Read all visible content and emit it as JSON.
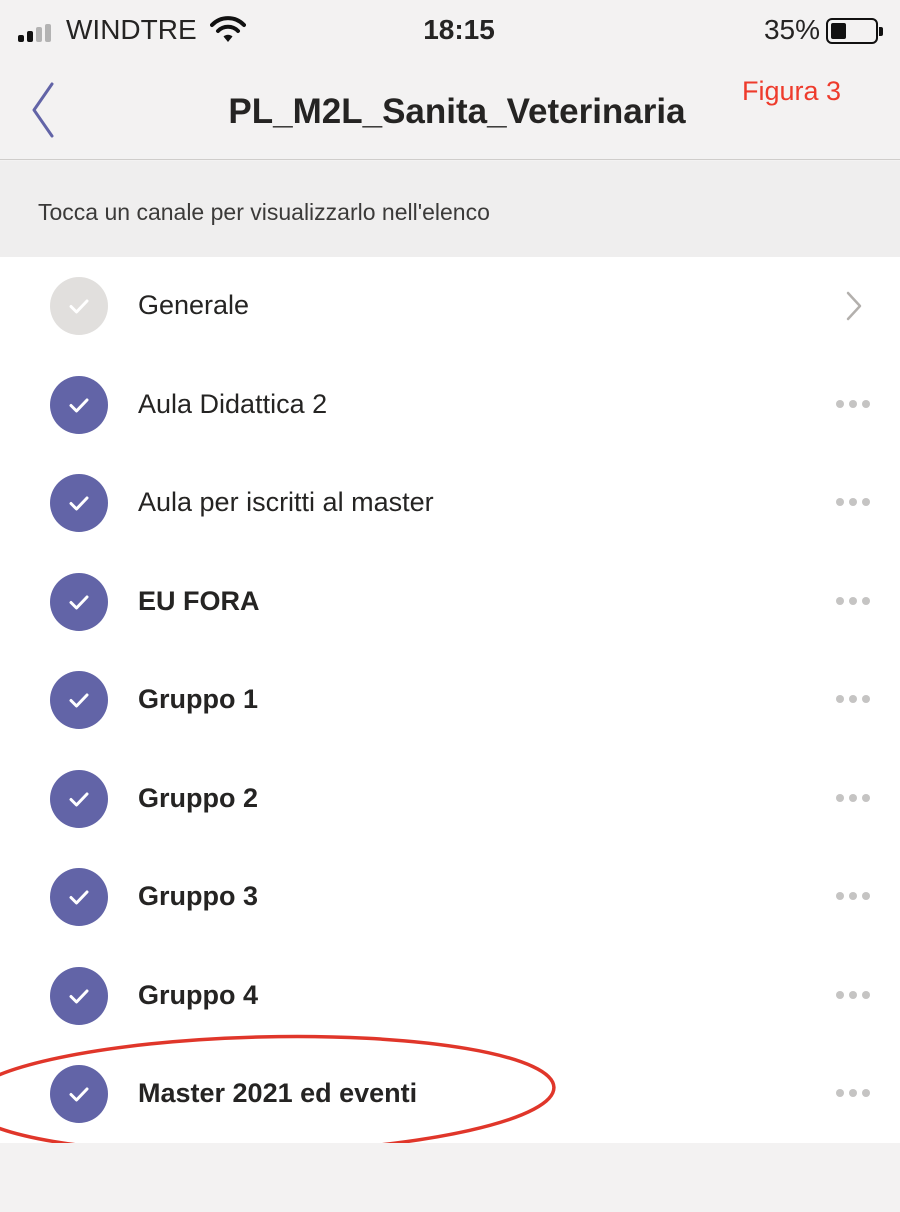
{
  "status_bar": {
    "carrier": "WINDTRE",
    "time": "18:15",
    "battery_percent": "35%",
    "battery_level": 0.35,
    "signal_bars_filled": 2,
    "signal_bars_total": 4
  },
  "nav": {
    "title": "PL_M2L_Sanita_Veterinaria",
    "figure_label": "Figura 3",
    "back_icon": "chevron-left-icon"
  },
  "hint": {
    "text": "Tocca un canale per visualizzarlo nell'elenco"
  },
  "channels": [
    {
      "label": "Generale",
      "checked": false,
      "bold": false,
      "trailing": "chevron-right-icon"
    },
    {
      "label": "Aula Didattica 2",
      "checked": true,
      "bold": false,
      "trailing": "more-icon"
    },
    {
      "label": "Aula per iscritti al master",
      "checked": true,
      "bold": false,
      "trailing": "more-icon"
    },
    {
      "label": "EU FORA",
      "checked": true,
      "bold": true,
      "trailing": "more-icon"
    },
    {
      "label": "Gruppo 1",
      "checked": true,
      "bold": true,
      "trailing": "more-icon"
    },
    {
      "label": "Gruppo 2",
      "checked": true,
      "bold": true,
      "trailing": "more-icon"
    },
    {
      "label": "Gruppo 3",
      "checked": true,
      "bold": true,
      "trailing": "more-icon"
    },
    {
      "label": "Gruppo 4",
      "checked": true,
      "bold": true,
      "trailing": "more-icon"
    },
    {
      "label": "Master 2021 ed eventi",
      "checked": true,
      "bold": true,
      "trailing": "more-icon"
    }
  ],
  "colors": {
    "accent": "#6264a7",
    "unchecked": "#e1dfdd",
    "annotation": "#e0362a",
    "figure_label": "#ee3b2c"
  }
}
